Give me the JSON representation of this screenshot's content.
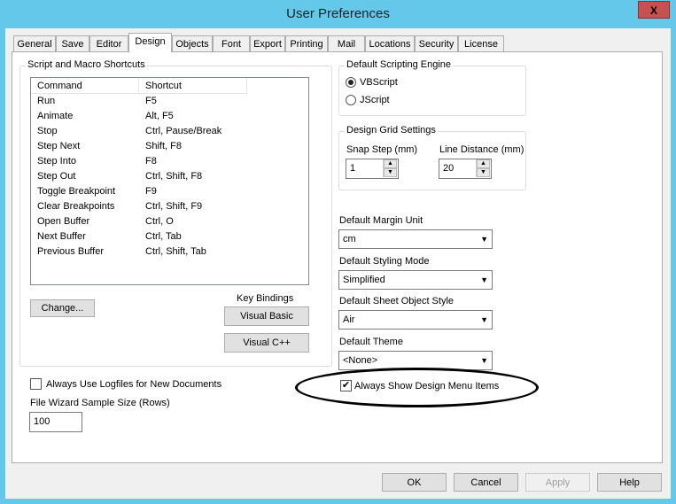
{
  "window": {
    "title": "User Preferences",
    "close_label": "X"
  },
  "tabs": [
    "General",
    "Save",
    "Editor",
    "Design",
    "Objects",
    "Font",
    "Export",
    "Printing",
    "Mail",
    "Locations",
    "Security",
    "License"
  ],
  "active_tab": "Design",
  "shortcuts": {
    "title": "Script and Macro Shortcuts",
    "columns": [
      "Command",
      "Shortcut"
    ],
    "rows": [
      [
        "Run",
        "F5"
      ],
      [
        "Animate",
        "Alt, F5"
      ],
      [
        "Stop",
        "Ctrl, Pause/Break"
      ],
      [
        "Step Next",
        "Shift, F8"
      ],
      [
        "Step Into",
        "F8"
      ],
      [
        "Step Out",
        "Ctrl, Shift, F8"
      ],
      [
        "Toggle Breakpoint",
        "F9"
      ],
      [
        "Clear Breakpoints",
        "Ctrl, Shift, F9"
      ],
      [
        "Open Buffer",
        "Ctrl, O"
      ],
      [
        "Next Buffer",
        "Ctrl, Tab"
      ],
      [
        "Previous Buffer",
        "Ctrl, Shift, Tab"
      ]
    ],
    "change_label": "Change...",
    "key_bindings_label": "Key Bindings",
    "visual_basic_label": "Visual Basic",
    "visual_cpp_label": "Visual C++"
  },
  "logfiles": {
    "label": "Always Use Logfiles for New Documents",
    "checked": false
  },
  "wizard": {
    "label": "File Wizard Sample Size (Rows)",
    "value": "100"
  },
  "scripting": {
    "title": "Default Scripting Engine",
    "options": [
      "VBScript",
      "JScript"
    ],
    "selected": "VBScript"
  },
  "grid": {
    "title": "Design Grid Settings",
    "snap_label": "Snap Step (mm)",
    "snap_value": "1",
    "line_label": "Line Distance (mm)",
    "line_value": "20"
  },
  "margin": {
    "label": "Default Margin Unit",
    "value": "cm"
  },
  "styling": {
    "label": "Default Styling Mode",
    "value": "Simplified"
  },
  "sheet_style": {
    "label": "Default Sheet Object Style",
    "value": "Air"
  },
  "theme": {
    "label": "Default Theme",
    "value": "<None>"
  },
  "design_menu": {
    "label": "Always Show Design Menu Items",
    "checked": true
  },
  "buttons": {
    "ok": "OK",
    "cancel": "Cancel",
    "apply": "Apply",
    "help": "Help"
  }
}
